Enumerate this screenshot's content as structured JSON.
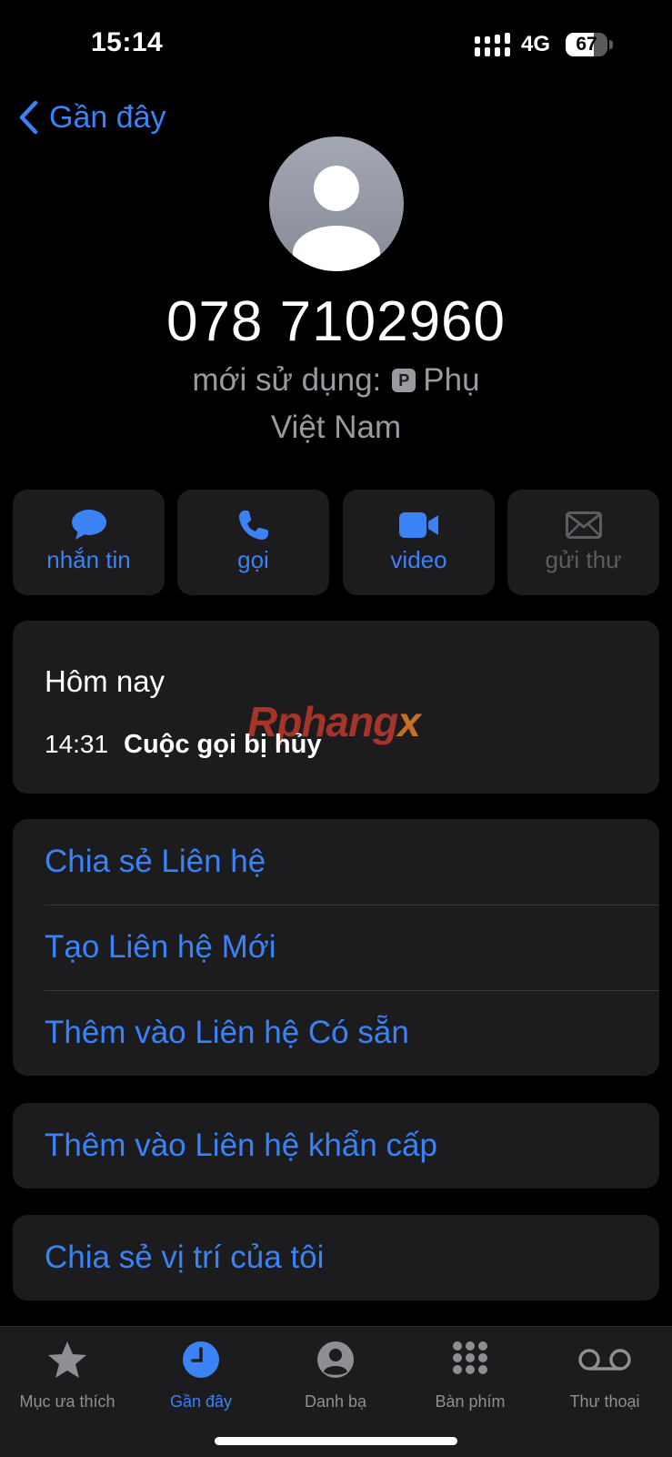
{
  "status_bar": {
    "time": "15:14",
    "network": "4G",
    "battery": 67
  },
  "nav": {
    "back_label": "Gần đây"
  },
  "contact": {
    "number": "078 7102960",
    "last_used_prefix": "mới sử dụng:",
    "sim_badge": "P",
    "sim_name": "Phụ",
    "country": "Việt Nam"
  },
  "actions": [
    {
      "label": "nhắn tin",
      "icon": "message-bubble-icon",
      "enabled": true
    },
    {
      "label": "gọi",
      "icon": "phone-icon",
      "enabled": true
    },
    {
      "label": "video",
      "icon": "video-camera-icon",
      "enabled": true
    },
    {
      "label": "gửi thư",
      "icon": "mail-icon",
      "enabled": false
    }
  ],
  "recents": {
    "day": "Hôm nay",
    "time": "14:31",
    "description": "Cuộc gọi bị hủy"
  },
  "watermark": {
    "part1": "Rphang",
    "part2": "x"
  },
  "options_group1": [
    "Chia sẻ Liên hệ",
    "Tạo Liên hệ Mới",
    "Thêm vào Liên hệ Có sẵn"
  ],
  "options_group2": [
    "Thêm vào Liên hệ khẩn cấp"
  ],
  "options_group3": [
    "Chia sẻ vị trí của tôi"
  ],
  "tabs": [
    {
      "label": "Mục ưa thích",
      "icon": "star-icon",
      "active": false
    },
    {
      "label": "Gần đây",
      "icon": "clock-icon",
      "active": true
    },
    {
      "label": "Danh bạ",
      "icon": "person-circle-icon",
      "active": false
    },
    {
      "label": "Bàn phím",
      "icon": "keypad-icon",
      "active": false
    },
    {
      "label": "Thư thoại",
      "icon": "voicemail-icon",
      "active": false
    }
  ],
  "colors": {
    "accent": "#3b82f6",
    "card": "#1c1c1e",
    "background": "#000000",
    "secondary_text": "#9a9aa0"
  }
}
